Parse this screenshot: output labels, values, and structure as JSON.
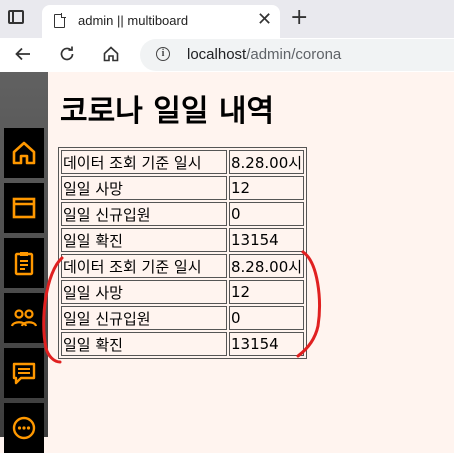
{
  "browser": {
    "tab_title": "admin || multiboard",
    "url_host": "localhost",
    "url_path": "/admin/corona"
  },
  "sidebar": {
    "items": [
      {
        "icon": "home-icon"
      },
      {
        "icon": "window-icon"
      },
      {
        "icon": "clipboard-icon"
      },
      {
        "icon": "people-icon"
      },
      {
        "icon": "message-icon"
      },
      {
        "icon": "chat-icon"
      }
    ],
    "icon_color": "#ff9800"
  },
  "page": {
    "title": "코로나 일일 내역"
  },
  "table": {
    "rows": [
      {
        "label": "데이터 조회 기준 일시",
        "value": "8.28.00시"
      },
      {
        "label": "일일 사망",
        "value": "12"
      },
      {
        "label": "일일 신규입원",
        "value": "0"
      },
      {
        "label": "일일 확진",
        "value": "13154"
      },
      {
        "label": "데이터 조회 기준 일시",
        "value": "8.28.00시"
      },
      {
        "label": "일일 사망",
        "value": "12"
      },
      {
        "label": "일일 신규입원",
        "value": "0"
      },
      {
        "label": "일일 확진",
        "value": "13154"
      }
    ]
  },
  "annotation_color": "#e02020"
}
